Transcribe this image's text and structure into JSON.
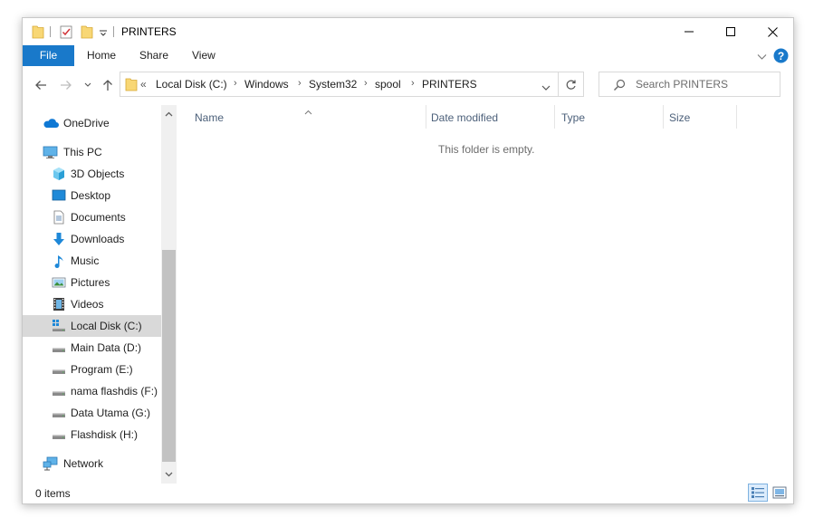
{
  "window": {
    "title": "PRINTERS"
  },
  "ribbon": {
    "tabs": [
      "File",
      "Home",
      "Share",
      "View"
    ]
  },
  "address": {
    "overflow": "«",
    "crumbs": [
      "Local Disk (C:)",
      "Windows",
      "System32",
      "spool",
      "PRINTERS"
    ]
  },
  "search": {
    "placeholder": "Search PRINTERS"
  },
  "sidebar": {
    "items": [
      {
        "label": "OneDrive",
        "icon": "onedrive-icon"
      },
      {
        "label": "This PC",
        "icon": "computer-icon"
      },
      {
        "label": "3D Objects",
        "icon": "cube-icon"
      },
      {
        "label": "Desktop",
        "icon": "desktop-icon"
      },
      {
        "label": "Documents",
        "icon": "document-icon"
      },
      {
        "label": "Downloads",
        "icon": "download-arrow-icon"
      },
      {
        "label": "Music",
        "icon": "music-note-icon"
      },
      {
        "label": "Pictures",
        "icon": "picture-icon"
      },
      {
        "label": "Videos",
        "icon": "film-icon"
      },
      {
        "label": "Local Disk (C:)",
        "icon": "windows-drive-icon"
      },
      {
        "label": "Main Data (D:)",
        "icon": "drive-icon"
      },
      {
        "label": "Program (E:)",
        "icon": "drive-icon"
      },
      {
        "label": "nama flashdis (F:)",
        "icon": "drive-icon"
      },
      {
        "label": "Data Utama (G:)",
        "icon": "drive-icon"
      },
      {
        "label": "Flashdisk (H:)",
        "icon": "drive-icon"
      },
      {
        "label": "Network",
        "icon": "network-icon"
      }
    ],
    "selected": "Local Disk (C:)"
  },
  "columns": [
    "Name",
    "Date modified",
    "Type",
    "Size"
  ],
  "content": {
    "empty_message": "This folder is empty."
  },
  "status": {
    "item_count": "0 items"
  },
  "colors": {
    "accent": "#1979ca",
    "folder": "#f8d775",
    "selection": "#d9d9d9",
    "help": "#1979ca"
  }
}
